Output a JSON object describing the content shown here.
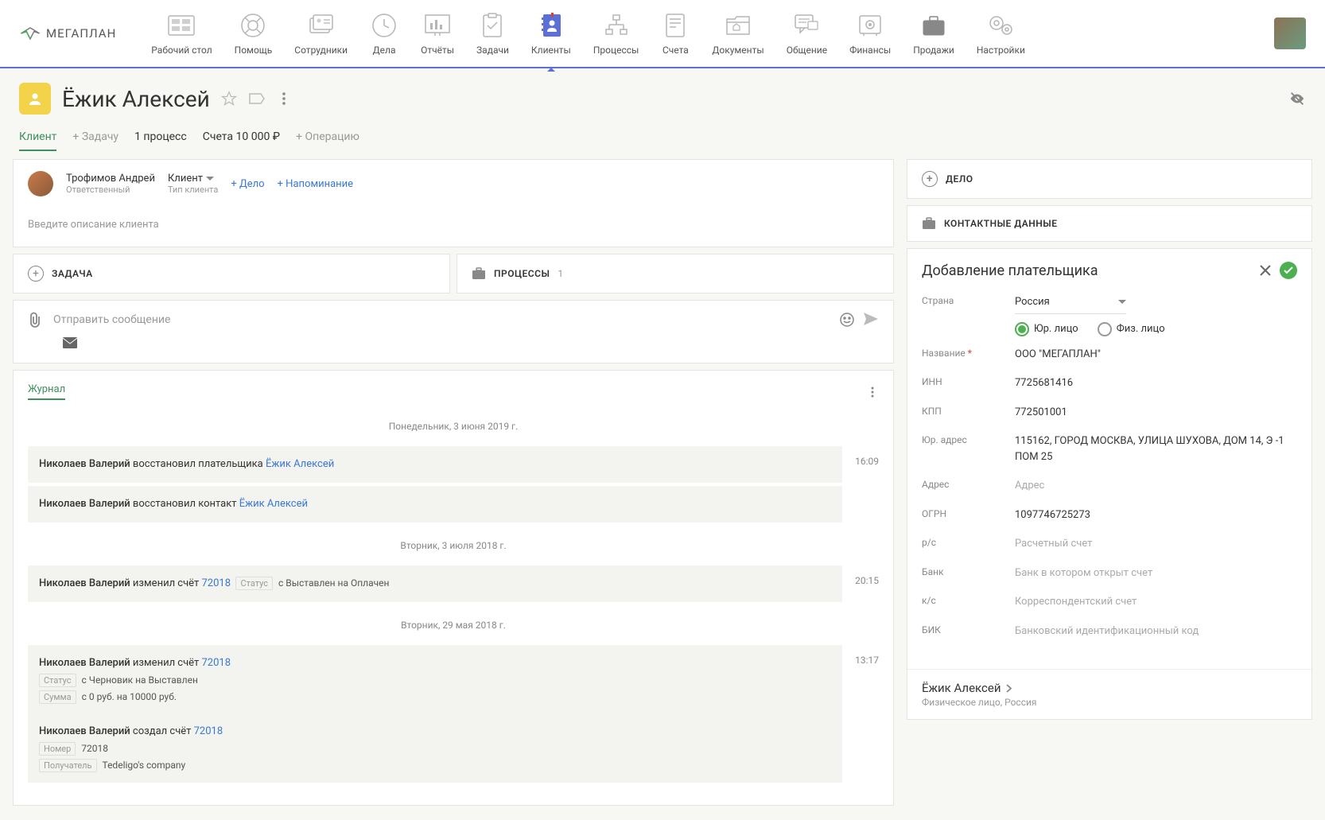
{
  "logo": "МЕГАПЛАН",
  "nav": [
    {
      "label": "Рабочий стол"
    },
    {
      "label": "Помощь"
    },
    {
      "label": "Сотрудники"
    },
    {
      "label": "Дела"
    },
    {
      "label": "Отчёты"
    },
    {
      "label": "Задачи"
    },
    {
      "label": "Клиенты"
    },
    {
      "label": "Процессы"
    },
    {
      "label": "Счета"
    },
    {
      "label": "Документы"
    },
    {
      "label": "Общение"
    },
    {
      "label": "Финансы"
    },
    {
      "label": "Продажи"
    },
    {
      "label": "Настройки"
    }
  ],
  "client": {
    "name": "Ёжик Алексей"
  },
  "tabs": {
    "client": "Клиент",
    "add_task": "+ Задачу",
    "process": "1 процесс",
    "invoices": "Счета 10 000 ₽",
    "add_operation": "+ Операцию"
  },
  "responsible": {
    "name": "Трофимов Андрей",
    "role": "Ответственный",
    "type_value": "Клиент",
    "type_label": "Тип клиента",
    "add_delo": "+ Дело",
    "add_reminder": "+ Напоминание"
  },
  "description_placeholder": "Введите описание клиента",
  "sections": {
    "task": "ЗАДАЧА",
    "processes": "ПРОЦЕССЫ",
    "processes_count": "1"
  },
  "message": {
    "placeholder": "Отправить сообщение"
  },
  "journal": {
    "label": "Журнал",
    "dates": {
      "d1": "Понедельник, 3 июня 2019 г.",
      "d2": "Вторник, 3 июля 2018 г.",
      "d3": "Вторник, 29 мая 2018 г."
    },
    "entries": {
      "e1": {
        "user": "Николаев Валерий",
        "action": " восстановил плательщика ",
        "link": "Ёжик Алексей",
        "time": "16:09"
      },
      "e2": {
        "user": "Николаев Валерий",
        "action": " восстановил контакт ",
        "link": "Ёжик Алексей"
      },
      "e3": {
        "user": "Николаев Валерий",
        "action": " изменил счёт ",
        "link": "72018",
        "status_lbl": "Статус",
        "status_val": " с Выставлен на Оплачен",
        "time": "20:15"
      },
      "e4": {
        "user": "Николаев Валерий",
        "action_change": " изменил счёт ",
        "link": "72018",
        "status_lbl": "Статус",
        "status_val": " с Черновик на Выставлен",
        "sum_lbl": "Сумма",
        "sum_val": " с 0 руб. на 10000 руб.",
        "time": "13:17",
        "action_create": " создал счёт ",
        "num_lbl": "Номер",
        "num_val": " 72018",
        "recv_lbl": "Получатель",
        "recv_val": " Tedeligo's company"
      }
    }
  },
  "side": {
    "delo": "ДЕЛО",
    "contacts": "КОНТАКТНЫЕ ДАННЫЕ",
    "payer": {
      "title": "Добавление плательщика",
      "country_label": "Страна",
      "country_value": "Россия",
      "entity_legal": "Юр. лицо",
      "entity_individual": "Физ. лицо",
      "name_label": "Название",
      "name_value": "ООО \"МЕГАПЛАН\"",
      "inn_label": "ИНН",
      "inn_value": "7725681416",
      "kpp_label": "КПП",
      "kpp_value": "772501001",
      "legal_addr_label": "Юр. адрес",
      "legal_addr_value": "115162, ГОРОД МОСКВА, УЛИЦА ШУХОВА, ДОМ 14, Э -1 ПОМ 25",
      "addr_label": "Адрес",
      "addr_placeholder": "Адрес",
      "ogrn_label": "ОГРН",
      "ogrn_value": "1097746725273",
      "rs_label": "р/с",
      "rs_placeholder": "Расчетный счет",
      "bank_label": "Банк",
      "bank_placeholder": "Банк в котором открыт счет",
      "ks_label": "к/с",
      "ks_placeholder": "Корреспондентский счет",
      "bik_label": "БИК",
      "bik_placeholder": "Банковский идентификационный код"
    },
    "footer": {
      "name": "Ёжик Алексей",
      "sub": "Физическое лицо, Россия"
    }
  }
}
